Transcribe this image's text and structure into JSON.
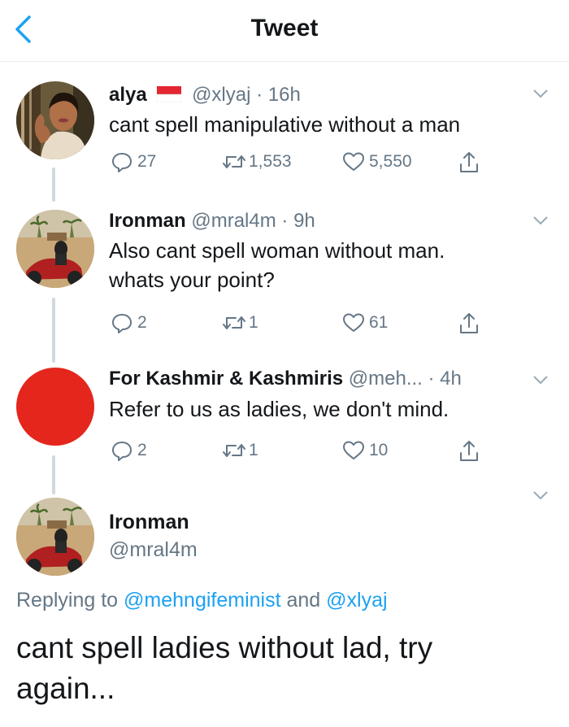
{
  "header": {
    "title": "Tweet"
  },
  "colors": {
    "accent": "#1da1f2",
    "muted": "#657786",
    "line": "#cfd9de"
  },
  "tweets": [
    {
      "name": "alya",
      "handle": "@xlyaj",
      "sep": "·",
      "time": "16h",
      "flag": "indonesia-flag",
      "text": "cant spell manipulative without a man",
      "replies": "27",
      "retweets": "1,553",
      "likes": "5,550"
    },
    {
      "name": "Ironman",
      "handle": "@mral4m",
      "sep": "·",
      "time": "9h",
      "text_lines": [
        "Also cant spell woman without man.",
        "whats your point?"
      ],
      "replies": "2",
      "retweets": "1",
      "likes": "61"
    },
    {
      "name": "For Kashmir & Kashmiris",
      "handle": "@meh...",
      "sep": "·",
      "time": "4h",
      "text": "Refer to us as ladies, we don't mind.",
      "replies": "2",
      "retweets": "1",
      "likes": "10"
    }
  ],
  "main_tweet": {
    "name": "Ironman",
    "handle": "@mral4m",
    "replying_prefix": "Replying to",
    "replying_user1": "@mehngifeminist",
    "replying_and": "and",
    "replying_user2": "@xlyaj",
    "text_lines": [
      "cant spell ladies without lad, try",
      "again..."
    ]
  }
}
